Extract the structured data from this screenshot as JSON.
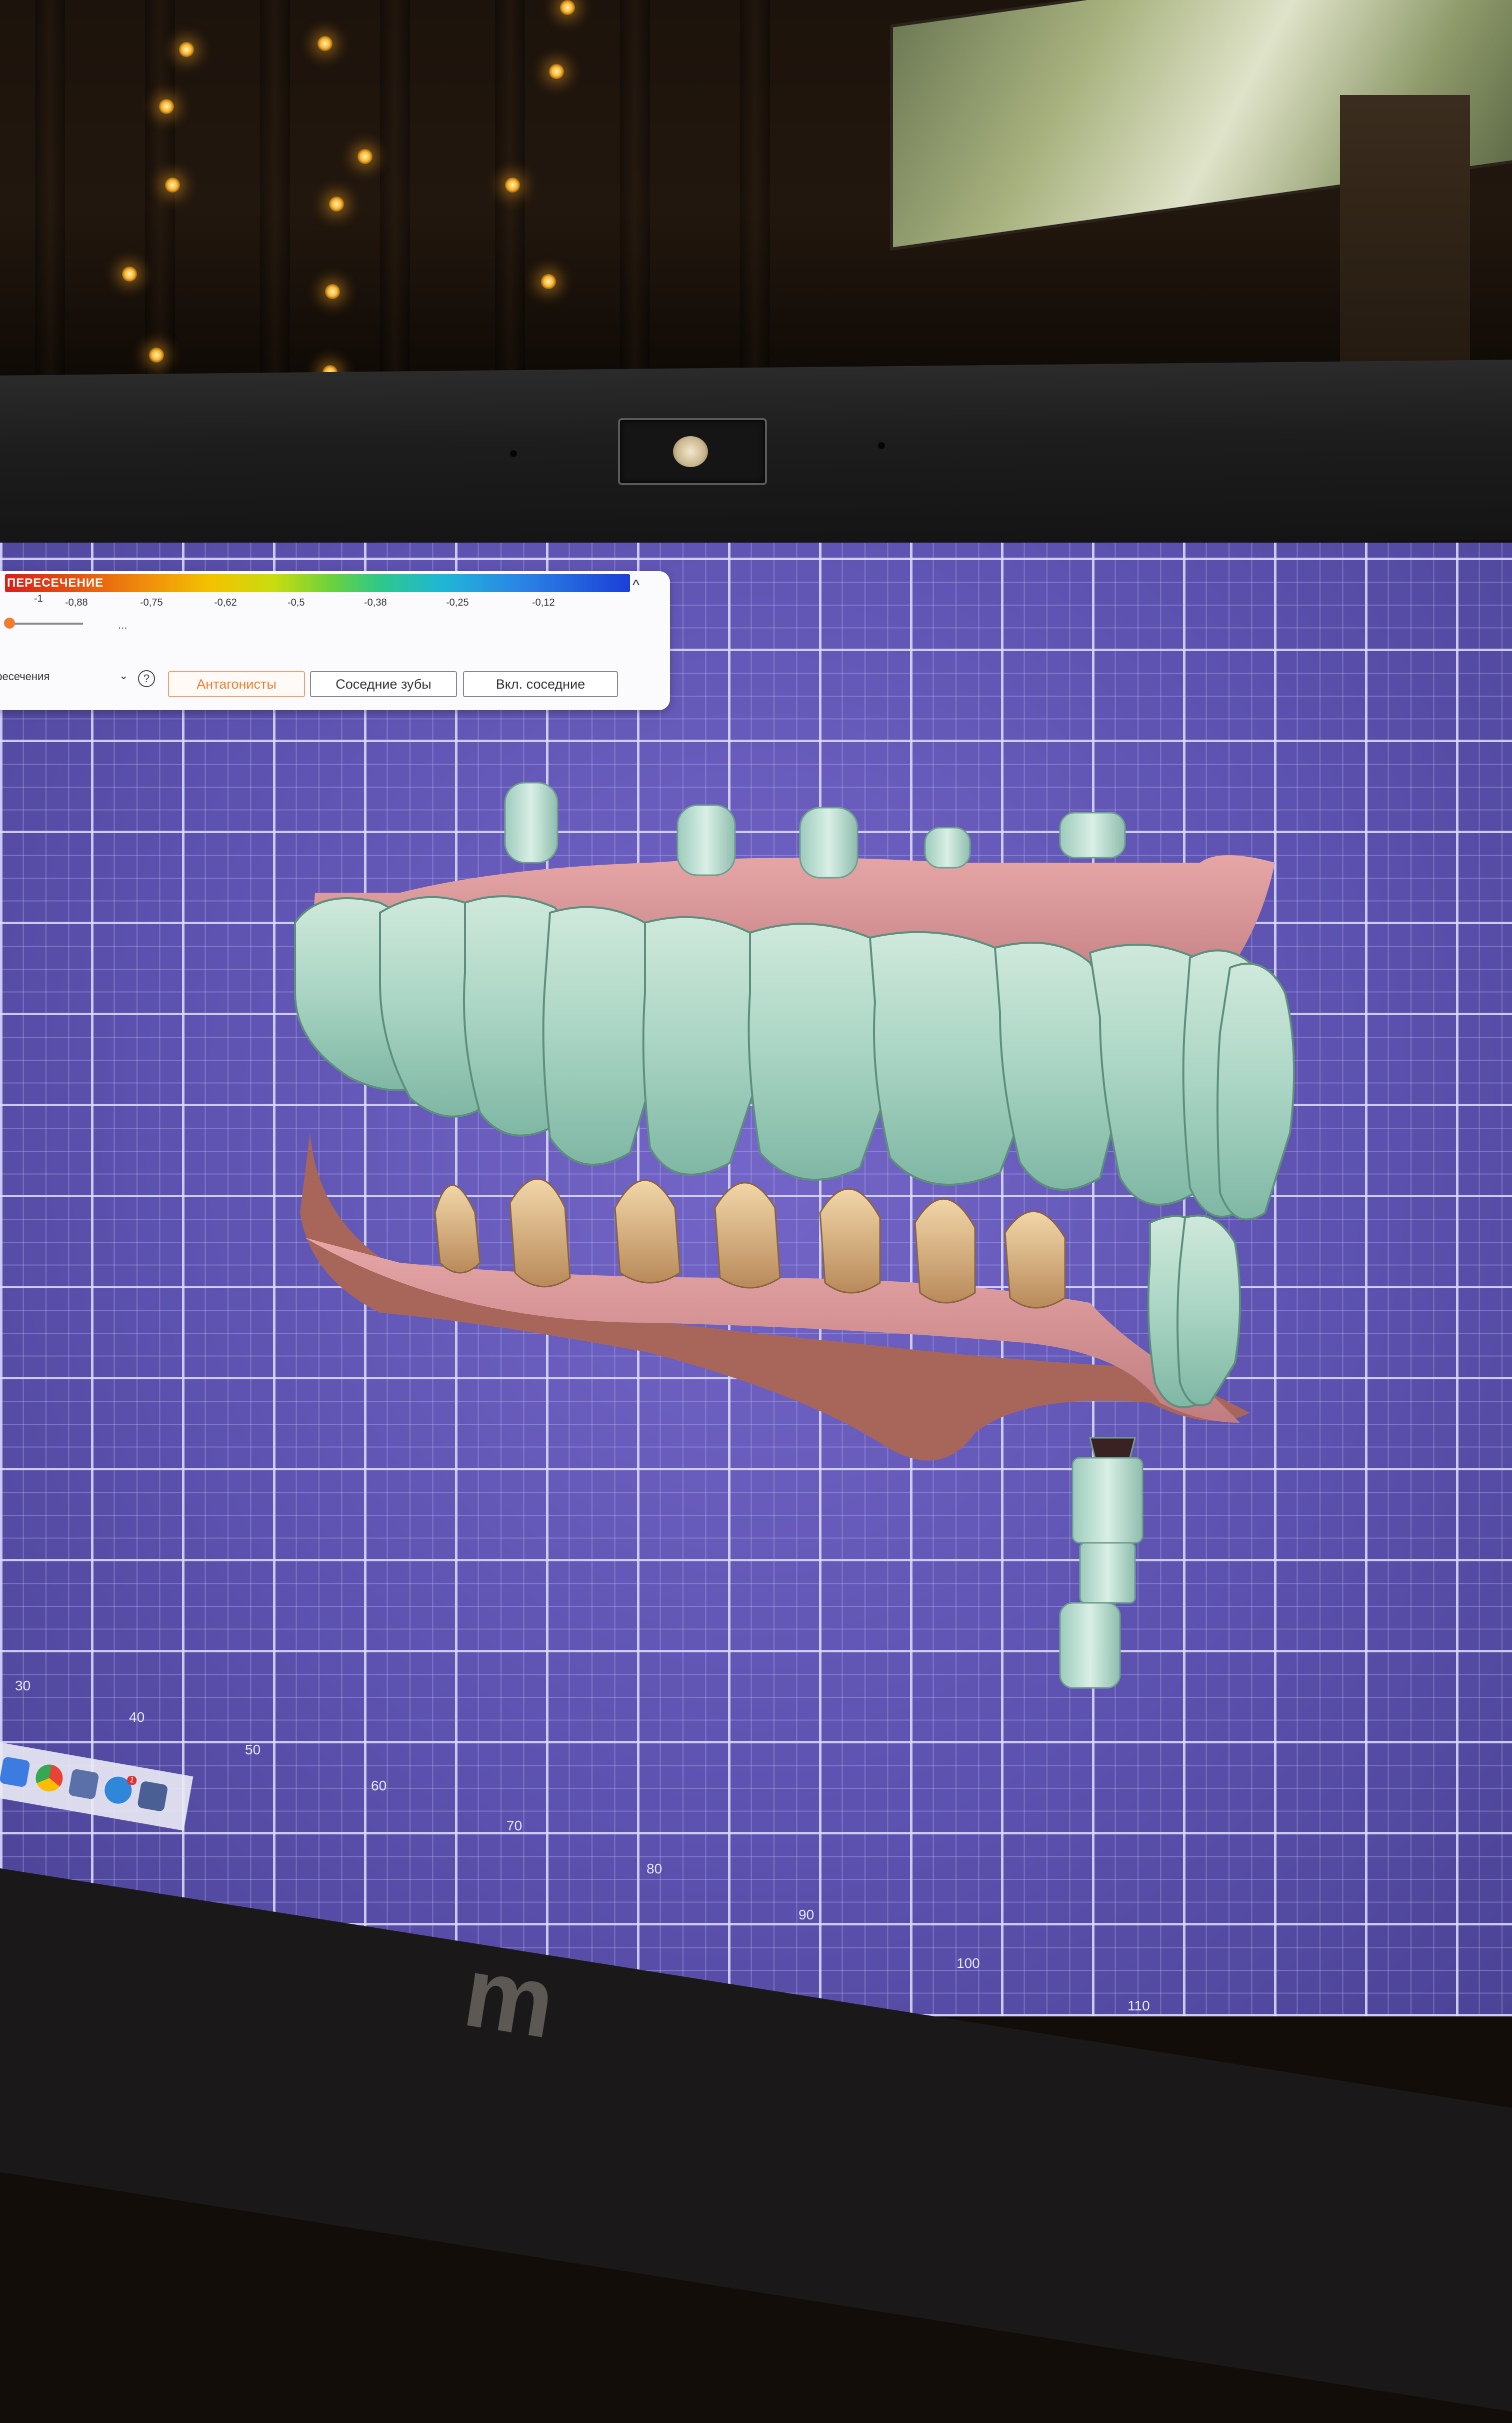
{
  "panel": {
    "title": "ПЕРЕСЕЧЕНИЕ",
    "scale_ticks": [
      "-1",
      "-0,88",
      "-0,75",
      "-0,62",
      "-0,5",
      "-0,38",
      "-0,25",
      "-0,12"
    ],
    "slider_more": "...",
    "mode_select_value": "ересечения",
    "help_symbol": "?",
    "collapse_symbol": "^",
    "buttons": {
      "antagonists": "Антагонисты",
      "adjacent_teeth": "Соседние зубы",
      "include_adjacent": "Вкл. соседние"
    },
    "colors": {
      "accent": "#f07c30",
      "scale_start": "#d6201a",
      "scale_end": "#1c3fd8"
    }
  },
  "viewport": {
    "background_color": "#5d52b0",
    "grid_color": "#dcdcff",
    "axis_labels": [
      "30",
      "40",
      "50",
      "60",
      "70",
      "80",
      "90",
      "100",
      "110"
    ]
  },
  "taskbar": {
    "icons": [
      "windows-icon",
      "chrome-icon",
      "exocad-icon",
      "app-badge-icon",
      "exocad-icon-2"
    ],
    "badge_count": "1"
  },
  "laptop": {
    "brand_text": "m"
  }
}
